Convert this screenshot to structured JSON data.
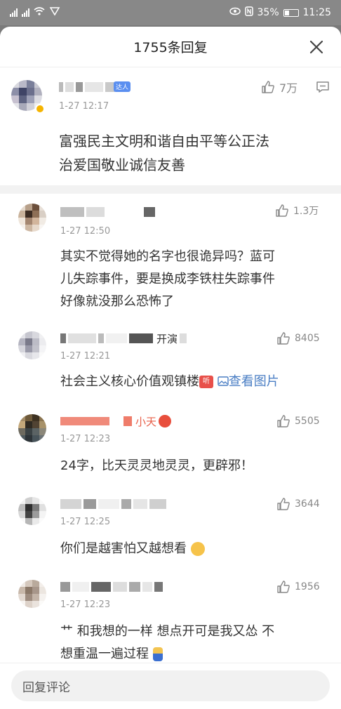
{
  "statusbar": {
    "battery_text": "35%",
    "clock": "11:25"
  },
  "header": {
    "title": "1755条回复"
  },
  "root": {
    "badge": "达人",
    "time": "1-27 12:17",
    "text_line1": "富强民主文明和谐自由平等公正法",
    "text_line2": "治爱国敬业诚信友善",
    "likes": "7万"
  },
  "replies": [
    {
      "time": "1-27 12:50",
      "likes": "1.3万",
      "lines": [
        "其实不觉得她的名字也很诡异吗？蓝可",
        "儿失踪事件，要是换成李铁柱失踪事件",
        "好像就没那么恐怖了"
      ]
    },
    {
      "name_tail": "开演",
      "time": "1-27 12:21",
      "likes": "8405",
      "text": "社会主义核心价值观镇楼",
      "emoji_tag": "听",
      "link": "查看图片"
    },
    {
      "name_tail": "小天",
      "time": "1-27 12:23",
      "likes": "5505",
      "text": "24字，比天灵灵地灵灵，更辟邪！"
    },
    {
      "time": "1-27 12:25",
      "likes": "3644",
      "text": "你们是越害怕又越想看"
    },
    {
      "time": "1-27 12:23",
      "likes": "1956",
      "lines": [
        "艹 和我想的一样 想点开可是我又怂 不",
        "想重温一遍过程"
      ]
    }
  ],
  "bottom": {
    "placeholder": "回复评论"
  },
  "colors": {
    "link": "#4a7ec4",
    "like_gray": "#888888",
    "time_gray": "#999999"
  },
  "icons": [
    "close-icon",
    "thumb-up-icon",
    "comment-icon",
    "image-icon"
  ]
}
